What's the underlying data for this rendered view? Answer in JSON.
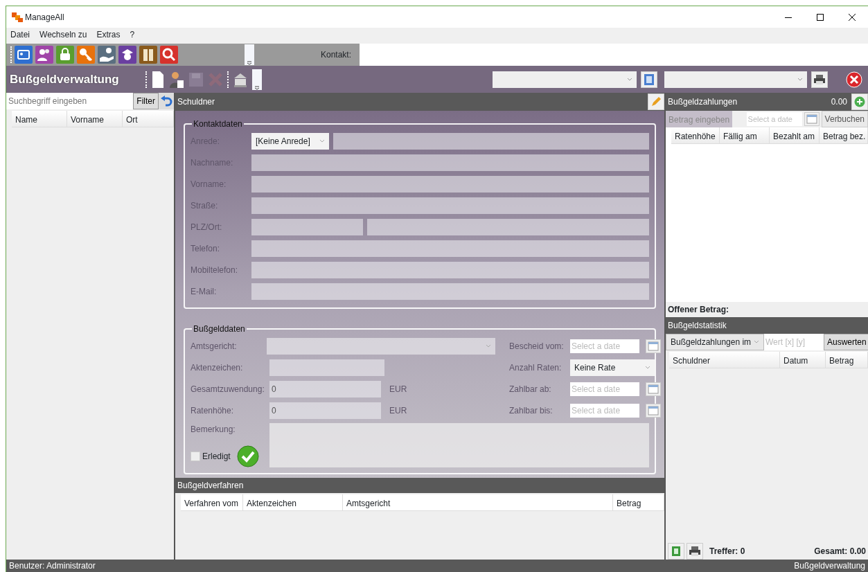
{
  "window": {
    "title": "ManageAll"
  },
  "menu": [
    {
      "label": "Datei"
    },
    {
      "label": "Wechseln zu"
    },
    {
      "label": "Extras"
    },
    {
      "label": "?"
    }
  ],
  "toolbar": {
    "contact_label": "Kontakt:"
  },
  "module": {
    "title": "Bußgeldverwaltung"
  },
  "search": {
    "placeholder": "Suchbegriff eingeben",
    "button": "Filter"
  },
  "list": {
    "columns": [
      "Name",
      "Vorname",
      "Ort"
    ]
  },
  "debtor": {
    "title": "Schuldner",
    "contact": {
      "legend": "Kontaktdaten",
      "disabled": true,
      "fields": [
        {
          "label": "Anrede:",
          "kind": "salutation",
          "value": "[Keine Anrede]"
        },
        {
          "label": "Nachname:",
          "kind": "text"
        },
        {
          "label": "Vorname:",
          "kind": "text"
        },
        {
          "label": "Straße:",
          "kind": "text"
        },
        {
          "label": "PLZ/Ort:",
          "kind": "zip_city"
        },
        {
          "label": "Telefon:",
          "kind": "text"
        },
        {
          "label": "Mobiltelefon:",
          "kind": "text"
        },
        {
          "label": "E-Mail:",
          "kind": "text"
        }
      ]
    },
    "fine": {
      "legend": "Bußgelddaten",
      "left": [
        {
          "label": "Amtsgericht:",
          "kind": "select"
        },
        {
          "label": "Aktenzeichen:",
          "kind": "text"
        },
        {
          "label": "Gesamtzuwendung:",
          "kind": "amount",
          "value": "0",
          "unit": "EUR"
        },
        {
          "label": "Ratenhöhe:",
          "kind": "amount",
          "value": "0",
          "unit": "EUR"
        }
      ],
      "right": [
        {
          "label": "Bescheid vom:",
          "kind": "date",
          "placeholder": "Select a date"
        },
        {
          "label": "Anzahl Raten:",
          "kind": "select",
          "value": "Keine Rate"
        },
        {
          "label": "Zahlbar ab:",
          "kind": "date",
          "placeholder": "Select a date"
        },
        {
          "label": "Zahlbar bis:",
          "kind": "date",
          "placeholder": "Select a date"
        }
      ],
      "remark_label": "Bemerkung:",
      "done": {
        "label": "Erledigt",
        "checked": false
      }
    }
  },
  "procedures": {
    "title": "Bußgeldverfahren",
    "columns": [
      "Verfahren vom",
      "Aktenzeichen",
      "Amtsgericht",
      "Betrag"
    ]
  },
  "payments": {
    "title": "Bußgeldzahlungen",
    "total": "0.00",
    "amount_tab": "Betrag eingeben",
    "date_placeholder": "Select a date",
    "button": "Verbuchen",
    "columns": [
      "Ratenhöhe",
      "Fällig am",
      "Bezahlt am",
      "Betrag bez."
    ],
    "open_amount": "Offener Betrag:"
  },
  "statistics": {
    "title": "Bußgeldstatistik",
    "select_value": "Bußgeldzahlungen im",
    "placeholder": "Wert [x] [y]",
    "button": "Auswerten",
    "columns": [
      "Schuldner",
      "Datum",
      "Betrag"
    ],
    "hits": "Treffer: 0",
    "sum": "Gesamt: 0.00"
  },
  "status_bar": {
    "user": "Benutzer: Administrator",
    "module": "Bußgeldverwaltung"
  }
}
